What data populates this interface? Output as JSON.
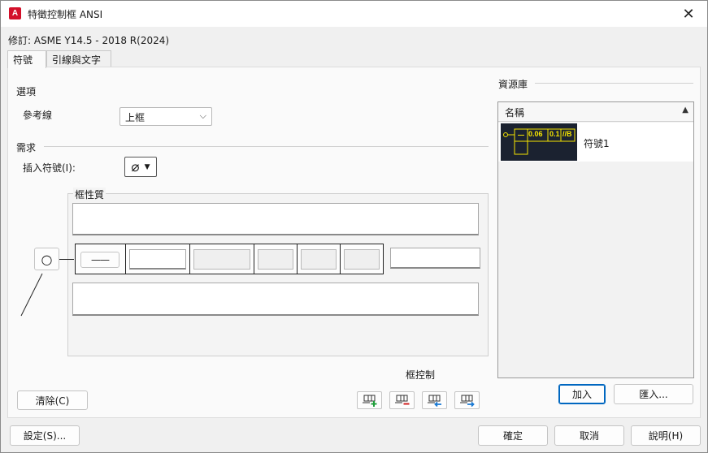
{
  "window": {
    "title": "特徵控制框 ANSI",
    "app_icon_letter": "A"
  },
  "revision": {
    "label": "修訂: ASME Y14.5 - 2018 R(2024)"
  },
  "tabs": [
    {
      "label": "符號"
    },
    {
      "label": "引線與文字"
    }
  ],
  "options": {
    "heading": "選項",
    "leader_label": "參考線",
    "leader_value": "上框"
  },
  "requirements": {
    "heading": "需求",
    "insert_symbol_label": "插入符號(I):",
    "insert_symbol_glyph": "⌀"
  },
  "frame_properties": {
    "title": "框性質",
    "first_cell_glyph": "——",
    "circle_glyph": "○"
  },
  "frame_control": {
    "label": "框控制",
    "buttons": [
      {
        "icon": "add-frame-icon"
      },
      {
        "icon": "remove-frame-icon"
      },
      {
        "icon": "move-frame-up-icon"
      },
      {
        "icon": "move-frame-down-icon"
      }
    ]
  },
  "library": {
    "title": "資源庫",
    "column_header": "名稱",
    "items": [
      {
        "name": "符號1",
        "thumb_values": [
          "0.06",
          "0.1",
          "//B"
        ]
      }
    ],
    "add_button": "加入",
    "import_button": "匯入..."
  },
  "buttons": {
    "clear": "清除(C)",
    "settings": "設定(S)...",
    "ok": "確定",
    "cancel": "取消",
    "help": "說明(H)"
  },
  "colors": {
    "accent": "#0067c0",
    "thumb_bg": "#1b2230",
    "thumb_fg": "#f5e400",
    "app_icon": "#d3102a"
  }
}
